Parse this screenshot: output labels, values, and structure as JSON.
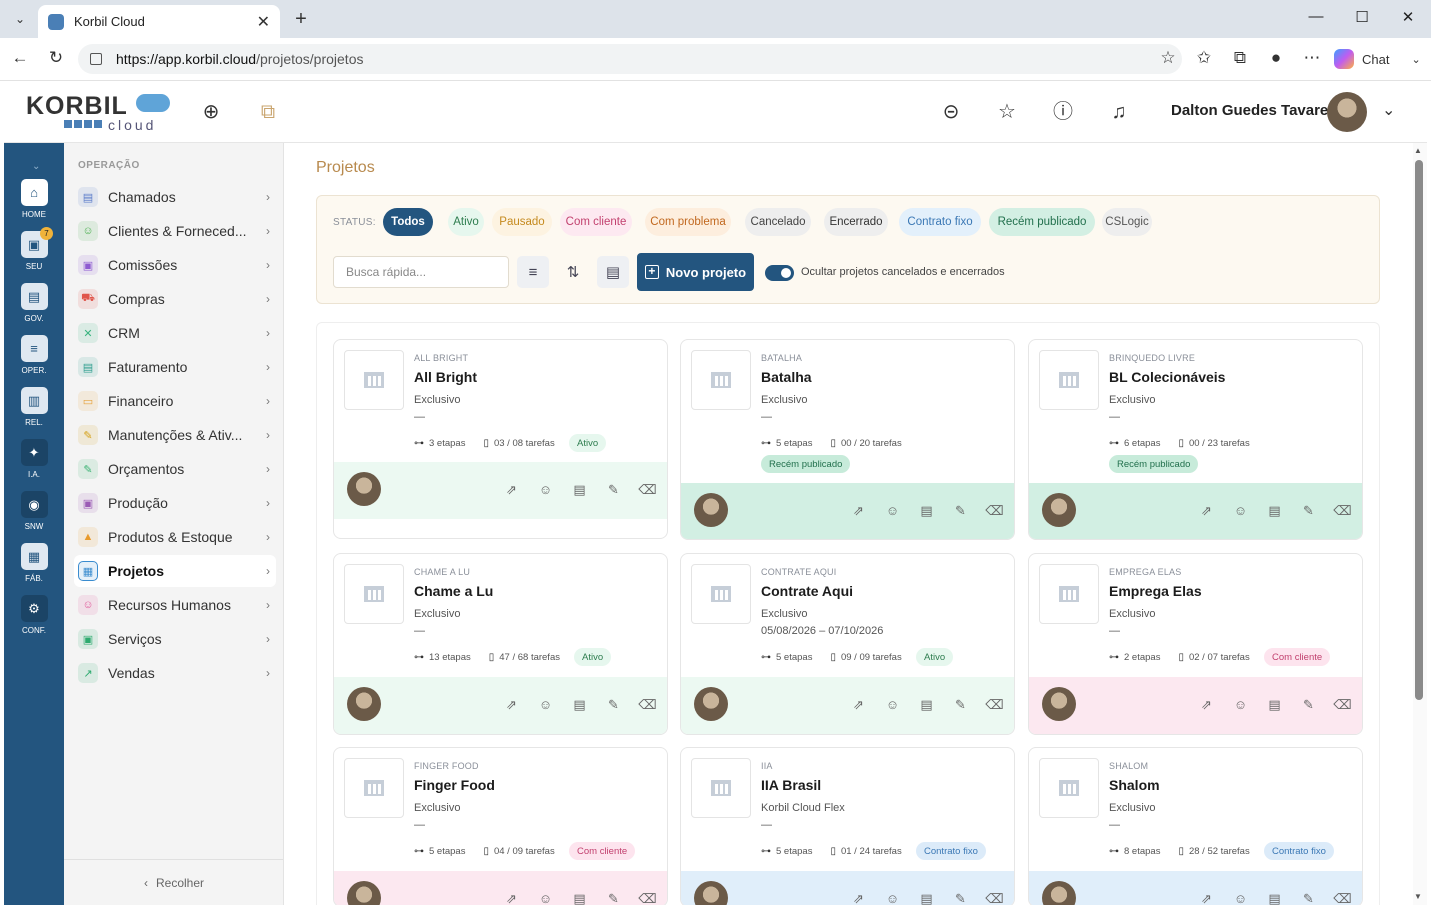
{
  "browser": {
    "tab_title": "Korbil Cloud",
    "url_host": "https://app.korbil.cloud",
    "url_path": "/projetos/projetos",
    "chat_label": "Chat"
  },
  "header": {
    "logo_text": "KORBIL",
    "logo_sub": "cloud",
    "user_name": "Dalton Guedes Tavares"
  },
  "rail": {
    "items": [
      {
        "label": "HOME",
        "icon": "home-icon"
      },
      {
        "label": "SEU",
        "icon": "briefcase-icon",
        "badge": "7"
      },
      {
        "label": "GOV.",
        "icon": "clipboard-icon"
      },
      {
        "label": "OPER.",
        "icon": "list-icon"
      },
      {
        "label": "REL.",
        "icon": "chart-icon"
      },
      {
        "label": "I.A.",
        "icon": "sparkle-icon"
      },
      {
        "label": "SNW",
        "icon": "globe-icon"
      },
      {
        "label": "FÁB.",
        "icon": "factory-icon"
      },
      {
        "label": "CONF.",
        "icon": "gear-icon"
      }
    ]
  },
  "sidebar": {
    "section_title": "OPERAÇÃO",
    "items": [
      {
        "label": "Chamados",
        "color": "#5b7cc9"
      },
      {
        "label": "Clientes & Forneced...",
        "color": "#4caf50"
      },
      {
        "label": "Comissões",
        "color": "#8e5bd1"
      },
      {
        "label": "Compras",
        "color": "#e0544a"
      },
      {
        "label": "CRM",
        "color": "#37b37e"
      },
      {
        "label": "Faturamento",
        "color": "#2f9e8f"
      },
      {
        "label": "Financeiro",
        "color": "#e6a23c"
      },
      {
        "label": "Manutenções & Ativ...",
        "color": "#d4a017"
      },
      {
        "label": "Orçamentos",
        "color": "#3bb273"
      },
      {
        "label": "Produção",
        "color": "#9b5bb5"
      },
      {
        "label": "Produtos & Estoque",
        "color": "#e89a2c"
      },
      {
        "label": "Projetos",
        "color": "#3a8ccf"
      },
      {
        "label": "Recursos Humanos",
        "color": "#e05a9a"
      },
      {
        "label": "Serviços",
        "color": "#2eaa6f"
      },
      {
        "label": "Vendas",
        "color": "#2eaa6f"
      }
    ],
    "collapse_label": "Recolher"
  },
  "main": {
    "title": "Projetos",
    "status_label": "STATUS:",
    "status_chips": [
      {
        "label": "Todos",
        "bg": "#23557f",
        "fg": "#ffffff"
      },
      {
        "label": "Ativo",
        "bg": "#e6f7ee",
        "fg": "#2e7d4f"
      },
      {
        "label": "Pausado",
        "bg": "#fdf3e1",
        "fg": "#c58a1e"
      },
      {
        "label": "Com cliente",
        "bg": "#fde9f1",
        "fg": "#c2416f"
      },
      {
        "label": "Com problema",
        "bg": "#fdeede",
        "fg": "#c1681f"
      },
      {
        "label": "Cancelado",
        "bg": "#eeeeee",
        "fg": "#444444"
      },
      {
        "label": "Encerrado",
        "bg": "#eeeeee",
        "fg": "#333333"
      },
      {
        "label": "Contrato fixo",
        "bg": "#e3f0fb",
        "fg": "#3b78b5"
      },
      {
        "label": "Recém publicado",
        "bg": "#d3efe3",
        "fg": "#22704d"
      },
      {
        "label": "CSLogic",
        "bg": "#eeeeee",
        "fg": "#555555"
      }
    ],
    "search_placeholder": "Busca rápida...",
    "new_project_label": "Novo projeto",
    "toggle_label": "Ocultar projetos cancelados e encerrados"
  },
  "projects": [
    {
      "client": "ALL BRIGHT",
      "name": "All Bright",
      "type": "Exclusivo",
      "dates": "—",
      "stages": "3 etapas",
      "tasks": "03 / 08 tarefas",
      "status": "Ativo",
      "status_bg": "#e6f7ee",
      "status_fg": "#2e7d4f",
      "footer_bg": "#ecf9f2",
      "chip_inline": true
    },
    {
      "client": "BATALHA",
      "name": "Batalha",
      "type": "Exclusivo",
      "dates": "—",
      "stages": "5 etapas",
      "tasks": "00 / 20 tarefas",
      "status": "Recém publicado",
      "status_bg": "#c7ebda",
      "status_fg": "#22704d",
      "footer_bg": "#d2efe3",
      "chip_inline": false
    },
    {
      "client": "BRINQUEDO LIVRE",
      "name": "BL Colecionáveis",
      "type": "Exclusivo",
      "dates": "—",
      "stages": "6 etapas",
      "tasks": "00 / 23 tarefas",
      "status": "Recém publicado",
      "status_bg": "#c7ebda",
      "status_fg": "#22704d",
      "footer_bg": "#d2efe3",
      "chip_inline": false
    },
    {
      "client": "CHAME A LU",
      "name": "Chame a Lu",
      "type": "Exclusivo",
      "dates": "—",
      "stages": "13 etapas",
      "tasks": "47 / 68 tarefas",
      "status": "Ativo",
      "status_bg": "#e6f7ee",
      "status_fg": "#2e7d4f",
      "footer_bg": "#ecf9f2",
      "chip_inline": true
    },
    {
      "client": "CONTRATE AQUI",
      "name": "Contrate Aqui",
      "type": "Exclusivo",
      "dates": "05/08/2026 – 07/10/2026",
      "stages": "5 etapas",
      "tasks": "09 / 09 tarefas",
      "status": "Ativo",
      "status_bg": "#e6f7ee",
      "status_fg": "#2e7d4f",
      "footer_bg": "#ecf9f2",
      "chip_inline": true
    },
    {
      "client": "EMPREGA ELAS",
      "name": "Emprega Elas",
      "type": "Exclusivo",
      "dates": "—",
      "stages": "2 etapas",
      "tasks": "02 / 07 tarefas",
      "status": "Com cliente",
      "status_bg": "#fde4ee",
      "status_fg": "#c2416f",
      "footer_bg": "#fce8f0",
      "chip_inline": true
    },
    {
      "client": "FINGER FOOD",
      "name": "Finger Food",
      "type": "Exclusivo",
      "dates": "—",
      "stages": "5 etapas",
      "tasks": "04 / 09 tarefas",
      "status": "Com cliente",
      "status_bg": "#fde4ee",
      "status_fg": "#c2416f",
      "footer_bg": "#fce8f0",
      "chip_inline": true
    },
    {
      "client": "IIA",
      "name": "IIA Brasil",
      "type": "Korbil Cloud Flex",
      "dates": "—",
      "stages": "5 etapas",
      "tasks": "01 / 24 tarefas",
      "status": "Contrato fixo",
      "status_bg": "#dcebf9",
      "status_fg": "#3b78b5",
      "footer_bg": "#e0eefa",
      "chip_inline": true
    },
    {
      "client": "SHALOM",
      "name": "Shalom",
      "type": "Exclusivo",
      "dates": "—",
      "stages": "8 etapas",
      "tasks": "28 / 52 tarefas",
      "status": "Contrato fixo",
      "status_bg": "#dcebf9",
      "status_fg": "#3b78b5",
      "footer_bg": "#e0eefa",
      "chip_inline": true
    }
  ]
}
